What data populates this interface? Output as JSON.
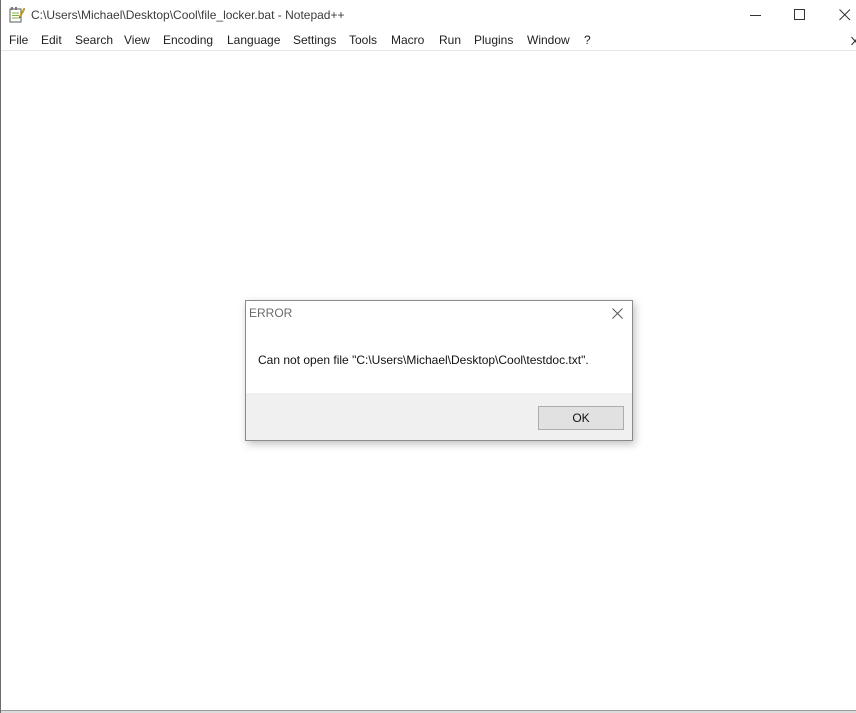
{
  "window": {
    "title": "C:\\Users\\Michael\\Desktop\\Cool\\file_locker.bat - Notepad++",
    "app_icon": "notepad-plus-plus-icon",
    "controls": [
      "minimize-icon",
      "maximize-icon",
      "close-icon"
    ]
  },
  "menubar": {
    "items": [
      {
        "label": "File"
      },
      {
        "label": "Edit"
      },
      {
        "label": "Search"
      },
      {
        "label": "View"
      },
      {
        "label": "Encoding"
      },
      {
        "label": "Language"
      },
      {
        "label": "Settings"
      },
      {
        "label": "Tools"
      },
      {
        "label": "Macro"
      },
      {
        "label": "Run"
      },
      {
        "label": "Plugins"
      },
      {
        "label": "Window"
      },
      {
        "label": "?"
      }
    ],
    "doc_close_icon": "close-icon"
  },
  "dialog": {
    "title": "ERROR",
    "message": "Can not open file \"C:\\Users\\Michael\\Desktop\\Cool\\testdoc.txt\".",
    "ok_label": "OK",
    "close_icon": "close-icon"
  },
  "colors": {
    "dialog_footer": "#f0f0f0",
    "button_face": "#e1e1e1",
    "button_border": "#adadad"
  }
}
